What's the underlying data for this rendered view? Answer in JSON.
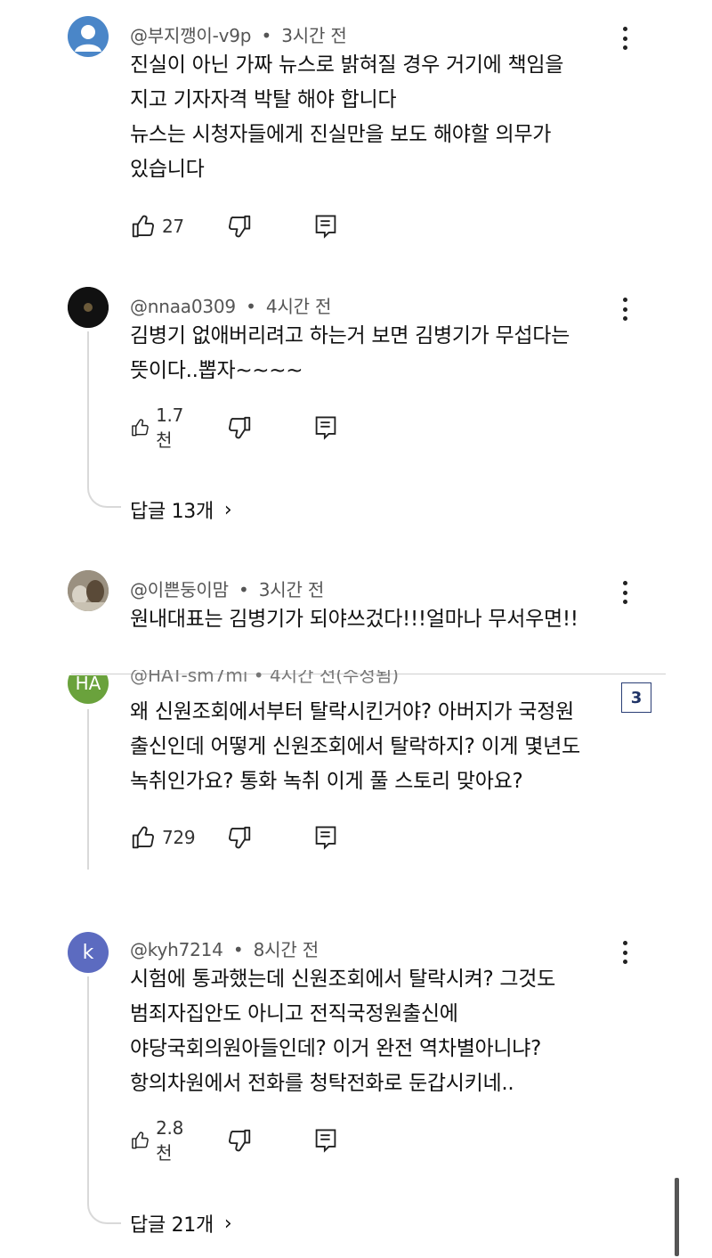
{
  "comments": [
    {
      "handle": "@부지깽이-v9p",
      "time": "3시간 전",
      "lines": [
        "진실이 아닌 가짜 뉴스로 밝혀질 경우 거기에 책임을",
        "지고 기자자격 박탈 해야 합니다",
        "뉴스는 시청자들에게 진실만을 보도 해야할 의무가",
        "있습니다"
      ],
      "likes": "27",
      "avatar_color": "#4a86c8",
      "avatar_icon": "person-icon"
    },
    {
      "handle": "@nnaa0309",
      "time": "4시간 전",
      "lines": [
        "김병기 없애버리려고 하는거 보면 김병기가 무섭다는",
        "뜻이다..뽑자~~~~"
      ],
      "likes": "1.7천",
      "replies": "답글 13개",
      "avatar_color": "#111111"
    },
    {
      "handle": "@이쁜둥이맘",
      "time": "3시간 전",
      "lines": [
        "원내대표는 김병기가 되야쓰겄다!!!얼마나 무서우면!!"
      ],
      "avatar_color": "#7d7466"
    },
    {
      "avatar_text": "HA",
      "avatar_color": "#6aa23c",
      "cut_meta": "@HAT-sm7mi • 4시간 전(수정됨)",
      "lines": [
        "왜 신원조회에서부터 탈락시킨거야? 아버지가 국정원",
        "출신인데 어떻게 신원조회에서 탈락하지? 이게 몇년도",
        "녹취인가요? 통화 녹취 이게 풀 스토리 맞아요?"
      ],
      "likes": "729"
    },
    {
      "handle": "@kyh7214",
      "time": "8시간 전",
      "avatar_text": "k",
      "avatar_color": "#5c6bc0",
      "lines": [
        "시험에 통과했는데 신원조회에서 탈락시켜? 그것도",
        "범죄자집안도 아니고 전직국정원출신에",
        "야당국회의원아들인데? 이거 완전 역차별아니냐?",
        "항의차원에서 전화를 청탁전화로 둔갑시키네.."
      ],
      "likes": "2.8천",
      "replies": "답글 21개"
    }
  ],
  "badge": "3",
  "separator": "•",
  "chevron": "›"
}
